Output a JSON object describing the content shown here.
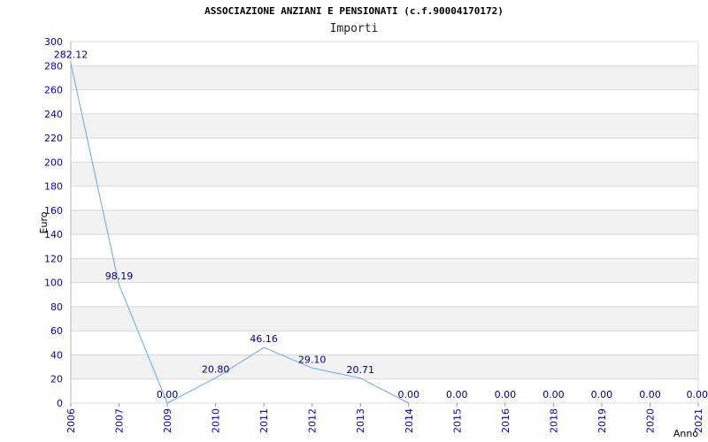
{
  "chart_data": {
    "type": "line",
    "title": "ASSOCIAZIONE ANZIANI E PENSIONATI (c.f.90004170172)",
    "subtitle": "Importi",
    "xlabel": "Anno",
    "ylabel": "Euro",
    "ylim": [
      0,
      300
    ],
    "yticks": [
      0,
      20,
      40,
      60,
      80,
      100,
      120,
      140,
      160,
      180,
      200,
      220,
      240,
      260,
      280,
      300
    ],
    "categories": [
      "2006",
      "2007",
      "2009",
      "2010",
      "2011",
      "2012",
      "2013",
      "2014",
      "2015",
      "2016",
      "2018",
      "2019",
      "2020",
      "2021"
    ],
    "values": [
      282.12,
      98.19,
      0,
      20.8,
      46.16,
      29.1,
      20.71,
      0,
      null,
      null,
      null,
      null,
      null,
      null
    ],
    "data_labels": [
      "282.12",
      "98.19",
      "0.00",
      "20.80",
      "46.16",
      "29.10",
      "20.71",
      "0.00",
      "0.00",
      "0.00",
      "0.00",
      "0.00",
      "0.00",
      "0.00"
    ],
    "grid": true,
    "colors": {
      "line": "#6aa9e9",
      "axis_text": "#0000cc",
      "label_text": "#000080",
      "band": "#f2f2f2",
      "grid": "#d8d8d8"
    }
  }
}
